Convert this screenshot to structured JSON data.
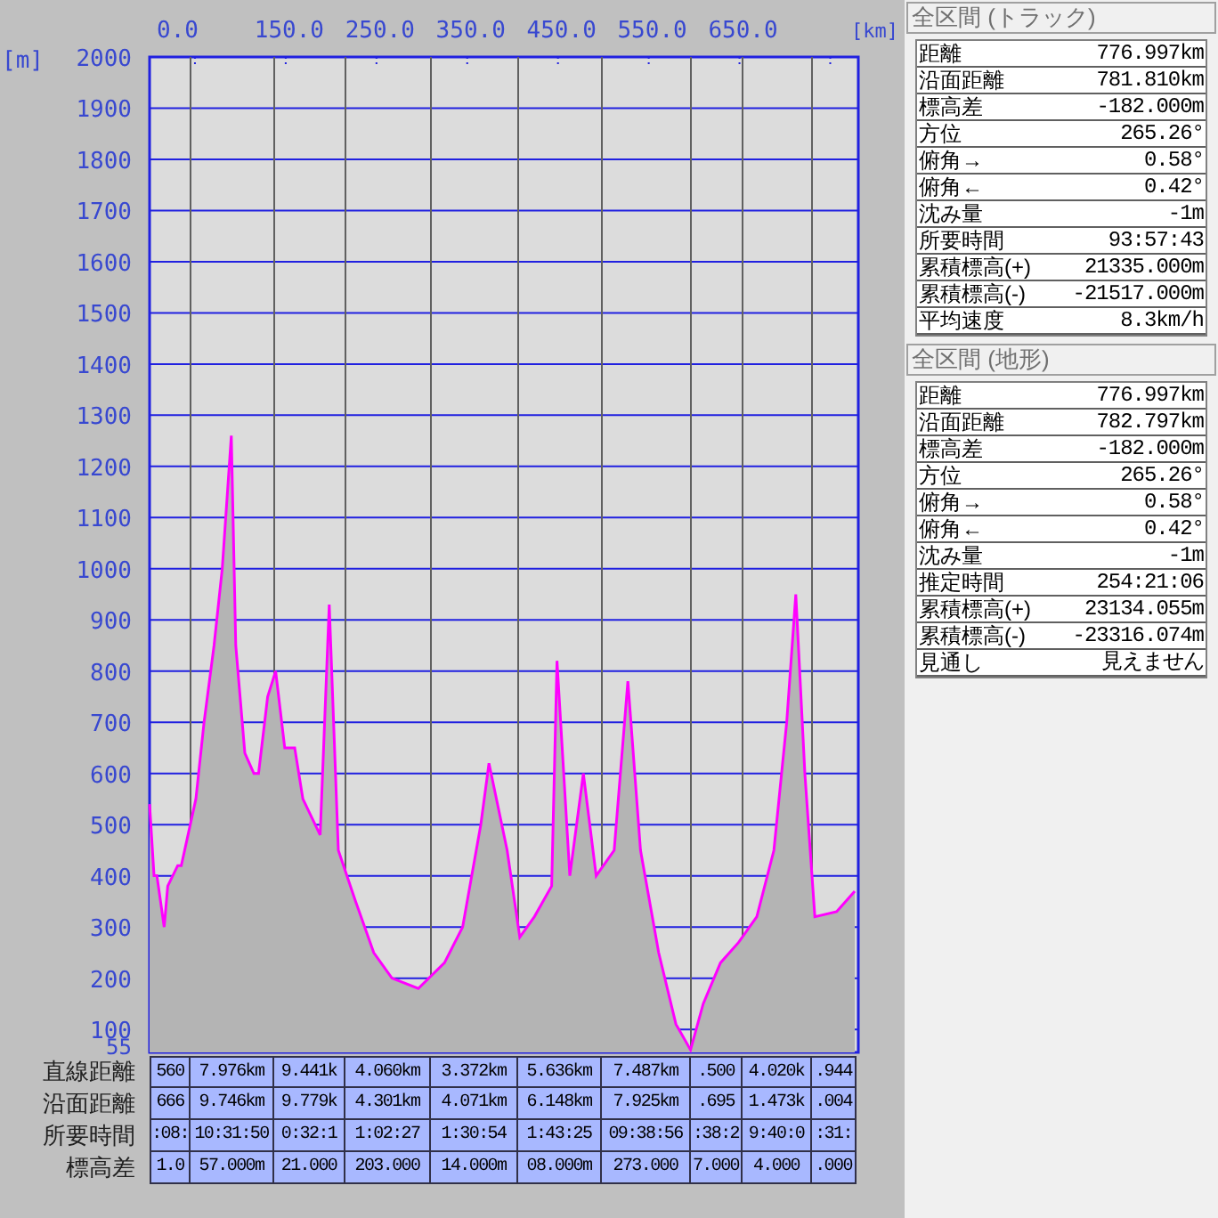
{
  "chart": {
    "chart_data": {
      "type": "area",
      "xlabel": "[km]",
      "ylabel": "[m]",
      "x": [
        0,
        5,
        8,
        16,
        20,
        31,
        35,
        51,
        60,
        71,
        80,
        90,
        95,
        105,
        115,
        120,
        130,
        139,
        149,
        160,
        169,
        188,
        198,
        208,
        227,
        247,
        267,
        296,
        325,
        345,
        365,
        374,
        394,
        408,
        424,
        443,
        449,
        463,
        478,
        492,
        512,
        527,
        541,
        561,
        580,
        596,
        610,
        629,
        649,
        669,
        688,
        702,
        712,
        722,
        733,
        757,
        776.997
      ],
      "series": [
        {
          "color": "#ff00ff",
          "values": [
            540,
            400,
            400,
            300,
            380,
            420,
            420,
            550,
            700,
            850,
            1000,
            1260,
            850,
            640,
            600,
            600,
            750,
            800,
            650,
            650,
            550,
            480,
            930,
            450,
            350,
            250,
            200,
            180,
            230,
            300,
            500,
            620,
            450,
            280,
            320,
            380,
            820,
            400,
            600,
            400,
            450,
            780,
            450,
            250,
            110,
            60,
            150,
            230,
            270,
            320,
            450,
            700,
            950,
            600,
            320,
            330,
            370
          ]
        }
      ],
      "grid": true,
      "xlim": [
        0,
        776.997
      ],
      "ylim": [
        55,
        2000
      ],
      "xticks": [
        {
          "value": 0,
          "label": "0.0"
        },
        {
          "value": 150,
          "label": "150.0"
        },
        {
          "value": 250,
          "label": "250.0"
        },
        {
          "value": 350,
          "label": "350.0"
        },
        {
          "value": 450,
          "label": "450.0"
        },
        {
          "value": 550,
          "label": "550.0"
        },
        {
          "value": 650,
          "label": "650.0"
        }
      ],
      "yticks": [
        55,
        {
          "value": 100,
          "label": "100"
        },
        200,
        300,
        400,
        500,
        600,
        700,
        800,
        900,
        1000,
        1100,
        1200,
        1300,
        1400,
        1500,
        1600,
        1700,
        1800,
        1900,
        2000
      ]
    }
  },
  "segment_table": {
    "rows": [
      {
        "label": "直線距離",
        "cells": [
          "560",
          "7.976km",
          "9.441k",
          "4.060km",
          "3.372km",
          "5.636km",
          "7.487km",
          ".500",
          "4.020k",
          ".944"
        ]
      },
      {
        "label": "沿面距離",
        "cells": [
          "666",
          "9.746km",
          "9.779k",
          "4.301km",
          "4.071km",
          "6.148km",
          "7.925km",
          ".695",
          "1.473k",
          ".004"
        ]
      },
      {
        "label": "所要時間",
        "cells": [
          ":08:",
          "10:31:50",
          "0:32:1",
          "1:02:27",
          "1:30:54",
          "1:43:25",
          "09:38:56",
          ":38:2",
          "9:40:0",
          ":31:"
        ]
      },
      {
        "label": "標高差",
        "cells": [
          "1.0",
          "57.000m",
          "21.000",
          "203.000",
          "14.000m",
          "08.000m",
          "273.000",
          "7.000",
          "4.000",
          ".000"
        ]
      }
    ]
  },
  "sections": [
    {
      "title": "全区間 (トラック)",
      "rows": [
        {
          "label": "距離",
          "value": "776.997km"
        },
        {
          "label": "沿面距離",
          "value": "781.810km"
        },
        {
          "label": "標高差",
          "value": "-182.000m"
        },
        {
          "label": "方位",
          "value": "265.26°"
        },
        {
          "label": "俯角→",
          "value": "0.58°"
        },
        {
          "label": "俯角←",
          "value": "0.42°"
        },
        {
          "label": "沈み量",
          "value": "-1m"
        },
        {
          "label": "所要時間",
          "value": "93:57:43"
        },
        {
          "label": "累積標高(+)",
          "value": "21335.000m"
        },
        {
          "label": "累積標高(-)",
          "value": "-21517.000m"
        },
        {
          "label": "平均速度",
          "value": "8.3km/h"
        }
      ]
    },
    {
      "title": "全区間 (地形)",
      "rows": [
        {
          "label": "距離",
          "value": "776.997km"
        },
        {
          "label": "沿面距離",
          "value": "782.797km"
        },
        {
          "label": "標高差",
          "value": "-182.000m"
        },
        {
          "label": "方位",
          "value": "265.26°"
        },
        {
          "label": "俯角→",
          "value": "0.58°"
        },
        {
          "label": "俯角←",
          "value": "0.42°"
        },
        {
          "label": "沈み量",
          "value": "-1m"
        },
        {
          "label": "推定時間",
          "value": "254:21:06"
        },
        {
          "label": "累積標高(+)",
          "value": "23134.055m"
        },
        {
          "label": "累積標高(-)",
          "value": "-23316.074m"
        },
        {
          "label": "見通し",
          "value": "見えません"
        }
      ]
    }
  ]
}
